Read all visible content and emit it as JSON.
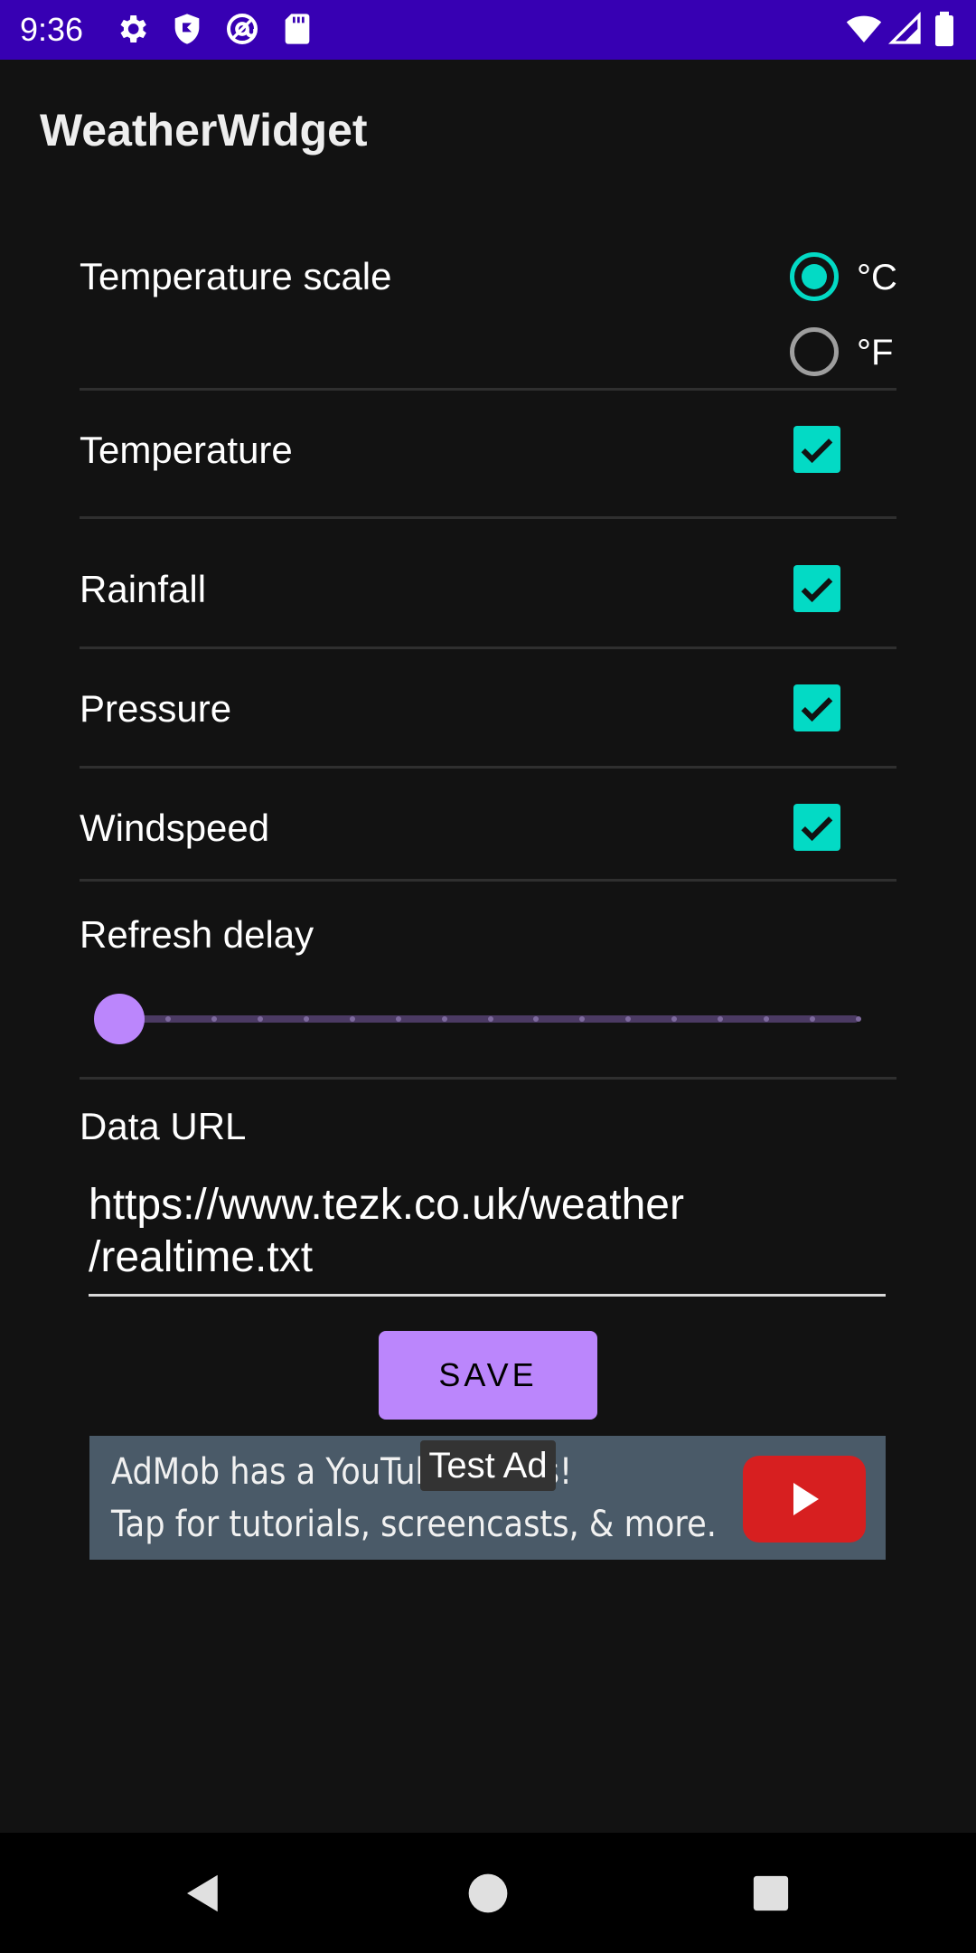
{
  "status_bar": {
    "time": "9:36",
    "left_icons": [
      "settings-icon",
      "shield-icon",
      "at-sign-icon",
      "sd-card-icon"
    ],
    "right_icons": [
      "wifi-icon",
      "signal-icon",
      "battery-icon"
    ],
    "background_color": "#3700b3"
  },
  "app_bar": {
    "title": "WeatherWidget"
  },
  "settings": {
    "temperature_scale": {
      "label": "Temperature scale",
      "options": [
        {
          "label": "°C",
          "selected": true
        },
        {
          "label": "°F",
          "selected": false
        }
      ]
    },
    "checkboxes": [
      {
        "label": "Temperature",
        "checked": true
      },
      {
        "label": "Rainfall",
        "checked": true
      },
      {
        "label": "Pressure",
        "checked": true
      },
      {
        "label": "Windspeed",
        "checked": true
      }
    ],
    "refresh_delay": {
      "label": "Refresh delay",
      "value_fraction": 0,
      "steps": 16
    },
    "data_url": {
      "label": "Data URL",
      "value": "https://www.tezk.co.uk/weather/realtime.txt"
    },
    "save_label": "SAVE"
  },
  "ad": {
    "line1": "AdMob has a YouTube series!",
    "line2": "Tap for tutorials, screencasts, & more.",
    "test_label": "Test Ad",
    "icon": "youtube-play-icon"
  },
  "nav_bar": {
    "icons": [
      "back-icon",
      "home-icon",
      "recents-icon"
    ]
  },
  "colors": {
    "accent": "#03dac5",
    "primary": "#bb86fc",
    "background": "#121212"
  }
}
